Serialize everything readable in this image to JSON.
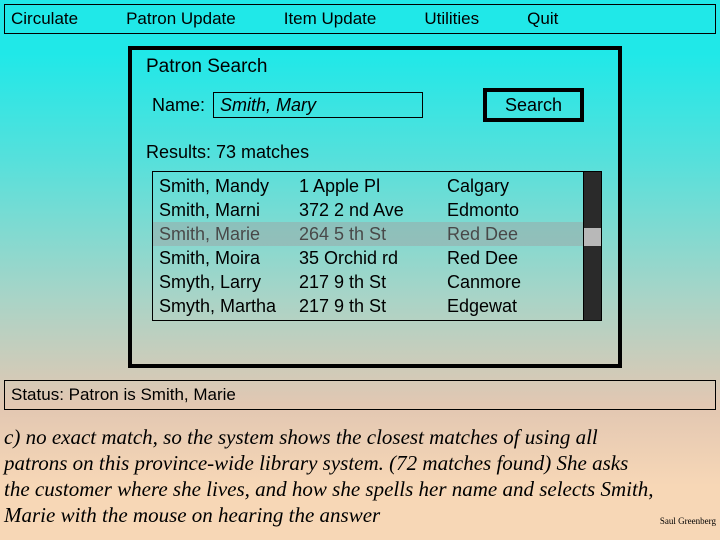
{
  "menu": {
    "circulate": "Circulate",
    "patron_update": "Patron Update",
    "item_update": "Item Update",
    "utilities": "Utilities",
    "quit": "Quit"
  },
  "panel": {
    "title": "Patron Search",
    "name_label": "Name:",
    "name_value": "Smith, Mary",
    "search_label": "Search",
    "results_label": "Results: 73 matches",
    "selected_index": 2,
    "rows": [
      {
        "name": "Smith, Mandy",
        "addr": "1 Apple Pl",
        "city": "Calgary"
      },
      {
        "name": "Smith, Marni",
        "addr": "372 2 nd Ave",
        "city": "Edmonto"
      },
      {
        "name": "Smith, Marie",
        "addr": "264 5 th St",
        "city": "Red Dee"
      },
      {
        "name": "Smith, Moira",
        "addr": "35 Orchid rd",
        "city": "Red Dee"
      },
      {
        "name": "Smyth, Larry",
        "addr": "217 9 th St",
        "city": "Canmore"
      },
      {
        "name": "Smyth, Martha",
        "addr": "217 9 th St",
        "city": "Edgewat"
      }
    ]
  },
  "status": "Status: Patron is Smith, Marie",
  "caption": "c) no exact match, so the system shows the closest matches of using all patrons on this province-wide library system. (72 matches found) She asks the customer where she lives, and how she spells her name and selects Smith, Marie with the mouse on hearing the answer",
  "credit": "Saul Greenberg"
}
